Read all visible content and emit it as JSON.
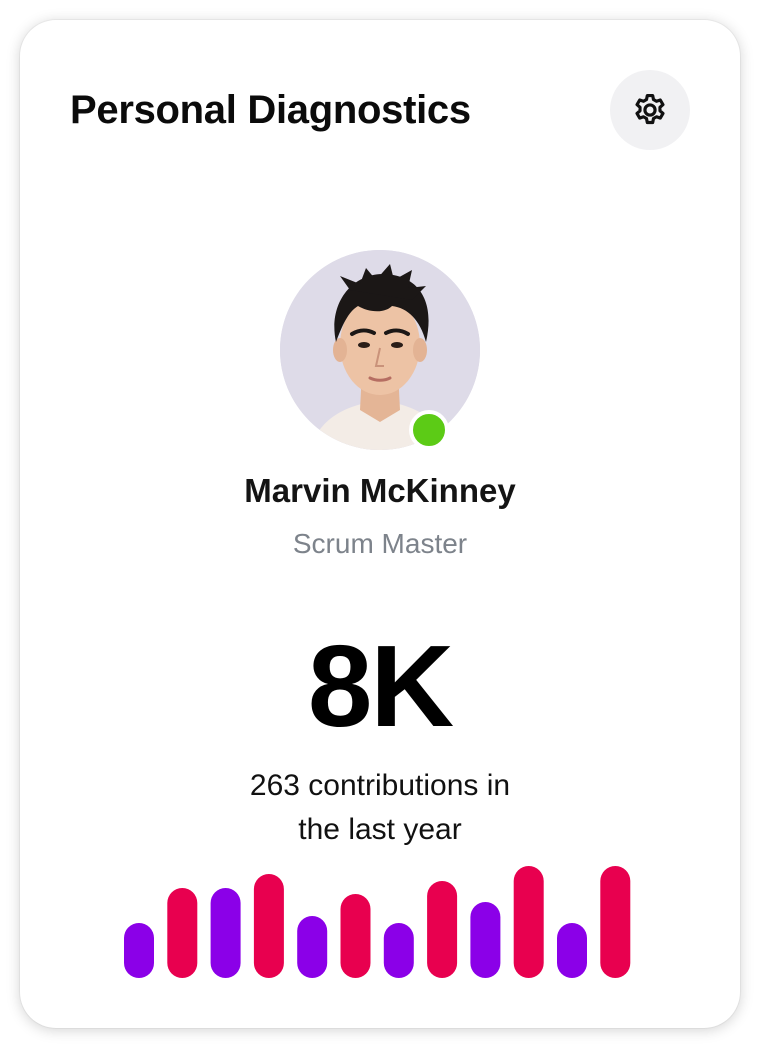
{
  "card": {
    "title": "Personal Diagnostics",
    "settings_icon": "gear-icon"
  },
  "profile": {
    "name": "Marvin McKinney",
    "role": "Scrum Master",
    "status": "online",
    "status_color": "#5CCB16"
  },
  "stats": {
    "value": "8K",
    "caption_line1": "263 contributions in",
    "caption_line2": "the last year"
  },
  "colors": {
    "purple": "#8B00E8",
    "pink": "#E8004F",
    "online": "#5CCB16"
  },
  "chart_data": {
    "type": "bar",
    "bars": [
      {
        "value": 55,
        "color": "#8B00E8"
      },
      {
        "value": 90,
        "color": "#E8004F"
      },
      {
        "value": 90,
        "color": "#8B00E8"
      },
      {
        "value": 104,
        "color": "#E8004F"
      },
      {
        "value": 62,
        "color": "#8B00E8"
      },
      {
        "value": 84,
        "color": "#E8004F"
      },
      {
        "value": 55,
        "color": "#8B00E8"
      },
      {
        "value": 97,
        "color": "#E8004F"
      },
      {
        "value": 76,
        "color": "#8B00E8"
      },
      {
        "value": 112,
        "color": "#E8004F"
      },
      {
        "value": 55,
        "color": "#8B00E8"
      },
      {
        "value": 112,
        "color": "#E8004F"
      }
    ],
    "ylim": [
      0,
      112
    ]
  }
}
